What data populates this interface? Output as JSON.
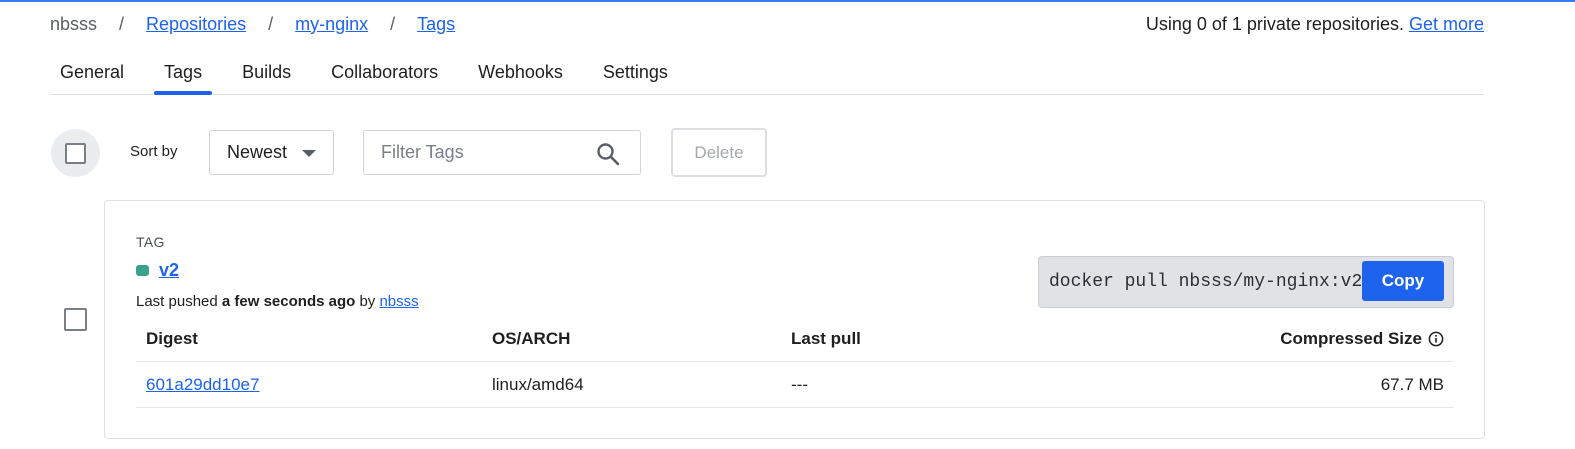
{
  "breadcrumb": {
    "namespace": "nbsss",
    "separator": "/",
    "repositories": "Repositories",
    "repo": "my-nginx",
    "current": "Tags"
  },
  "usage": {
    "text": "Using 0 of 1 private repositories.",
    "link": "Get more"
  },
  "tabs": [
    {
      "label": "General"
    },
    {
      "label": "Tags",
      "active": true
    },
    {
      "label": "Builds"
    },
    {
      "label": "Collaborators"
    },
    {
      "label": "Webhooks"
    },
    {
      "label": "Settings"
    }
  ],
  "toolbar": {
    "sort_label": "Sort by",
    "sort_value": "Newest",
    "filter_placeholder": "Filter Tags",
    "delete_label": "Delete"
  },
  "tag": {
    "heading": "TAG",
    "name": "v2",
    "status_color": "#3aa28c",
    "pushed_prefix": "Last pushed",
    "pushed_time": "a few seconds ago",
    "pushed_by_word": "by",
    "pushed_by_user": "nbsss",
    "pull_command": "docker pull nbsss/my-nginx:v2",
    "copy_label": "Copy"
  },
  "digest_table": {
    "headers": {
      "digest": "Digest",
      "os_arch": "OS/ARCH",
      "last_pull": "Last pull",
      "size": "Compressed Size"
    },
    "rows": [
      {
        "digest": "601a29dd10e7",
        "os_arch": "linux/amd64",
        "last_pull": "---",
        "size": "67.7 MB"
      }
    ]
  },
  "colors": {
    "accent": "#1d63ed",
    "status_active": "#3aa28c"
  }
}
